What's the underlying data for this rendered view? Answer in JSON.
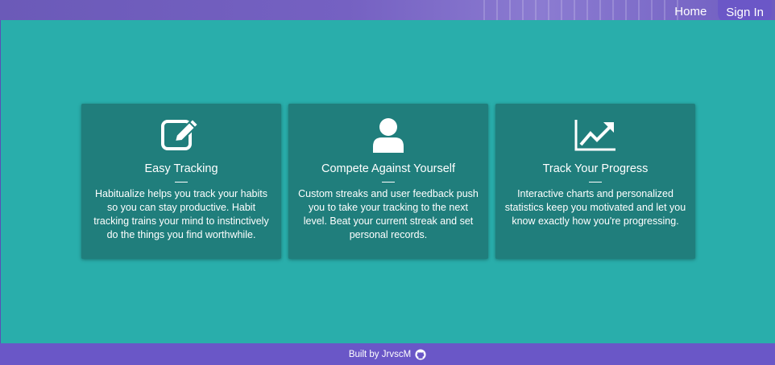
{
  "nav": {
    "home_label": "Home",
    "signin_label": "Sign In"
  },
  "features": [
    {
      "icon": "edit-icon",
      "title": "Easy Tracking",
      "text": "Habitualize helps you track your habits so you can stay productive. Habit tracking trains your mind to instinctively do the things you find worthwhile."
    },
    {
      "icon": "user-icon",
      "title": "Compete Against Yourself",
      "text": "Custom streaks and user feedback push you to take your tracking to the next level. Beat your current streak and set personal records."
    },
    {
      "icon": "line-chart-icon",
      "title": "Track Your Progress",
      "text": "Interactive charts and personalized statistics keep you motivated and let you know exactly how you're progressing."
    }
  ],
  "footer": {
    "text": "Built by JrvscM",
    "icon": "github-icon"
  },
  "colors": {
    "background": "#29aeab",
    "card": "#207e7c",
    "accent": "#6a57c7"
  }
}
